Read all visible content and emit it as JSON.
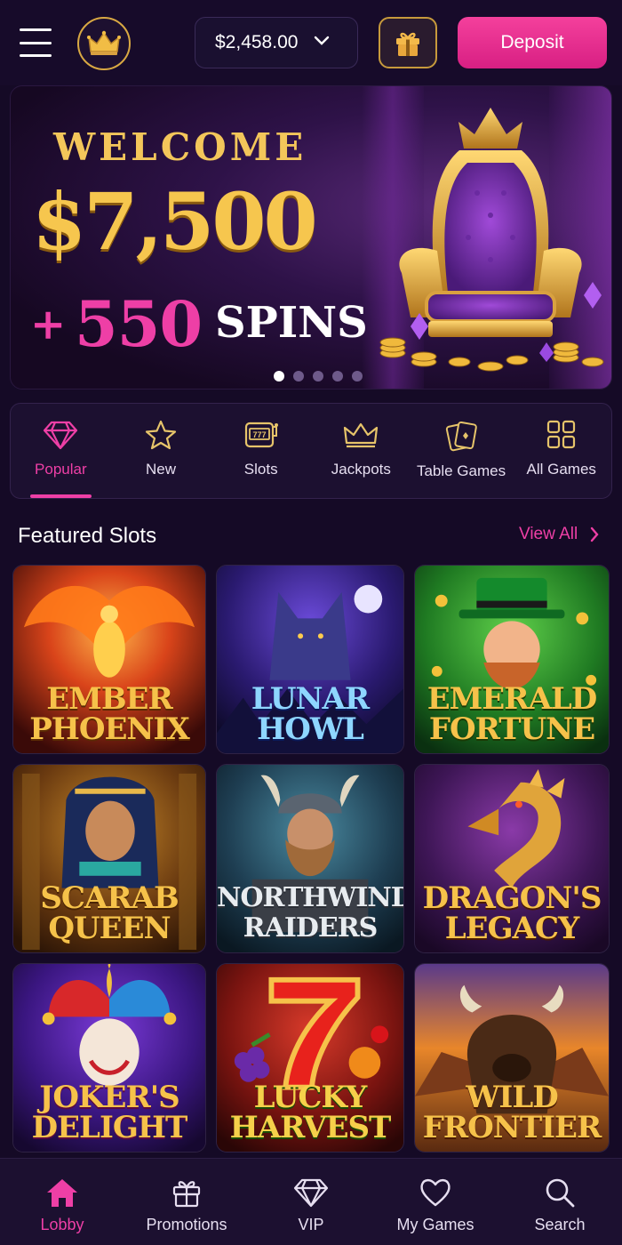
{
  "header": {
    "balance": "$2,458.00",
    "deposit_label": "Deposit",
    "icons": [
      "menu-icon",
      "crown-logo-icon",
      "chevron-down-icon",
      "gift-icon"
    ]
  },
  "hero": {
    "welcome": "WELCOME",
    "amount": "$7,500",
    "plus": "+",
    "spins_count": "550",
    "spins_word": "SPINS",
    "slides": 5,
    "active_slide": 1
  },
  "categories": [
    {
      "label": "Popular",
      "icon": "diamond-icon",
      "active": true
    },
    {
      "label": "New",
      "icon": "star-icon",
      "active": false
    },
    {
      "label": "Slots",
      "icon": "slot-machine-icon",
      "active": false
    },
    {
      "label": "Jackpots",
      "icon": "crown-icon",
      "active": false
    },
    {
      "label": "Table Games",
      "icon": "cards-icon",
      "active": false
    },
    {
      "label": "All Games",
      "icon": "grid-icon",
      "active": false
    }
  ],
  "featured": {
    "title": "Featured Slots",
    "view_all": "View All",
    "games": [
      {
        "line1": "EMBER",
        "line2": "PHOENIX"
      },
      {
        "line1": "LUNAR",
        "line2": "HOWL"
      },
      {
        "line1": "EMERALD",
        "line2": "FORTUNE"
      },
      {
        "line1": "SCARAB",
        "line2": "QUEEN"
      },
      {
        "line1": "NORTHWIND",
        "line2": "RAIDERS"
      },
      {
        "line1": "DRAGON'S",
        "line2": "LEGACY"
      },
      {
        "line1": "JOKER'S",
        "line2": "DELIGHT"
      },
      {
        "line1": "LUCKY",
        "line2": "HARVEST"
      },
      {
        "line1": "WILD",
        "line2": "FRONTIER"
      }
    ]
  },
  "bottom_nav": [
    {
      "label": "Lobby",
      "icon": "home-icon",
      "active": true
    },
    {
      "label": "Promotions",
      "icon": "gift-icon",
      "active": false
    },
    {
      "label": "VIP",
      "icon": "diamond-icon",
      "active": false
    },
    {
      "label": "My Games",
      "icon": "heart-icon",
      "active": false
    },
    {
      "label": "Search",
      "icon": "search-icon",
      "active": false
    }
  ],
  "colors": {
    "background": "#150a26",
    "accent_pink": "#ee3fa6",
    "gold": "#f3c65a"
  }
}
